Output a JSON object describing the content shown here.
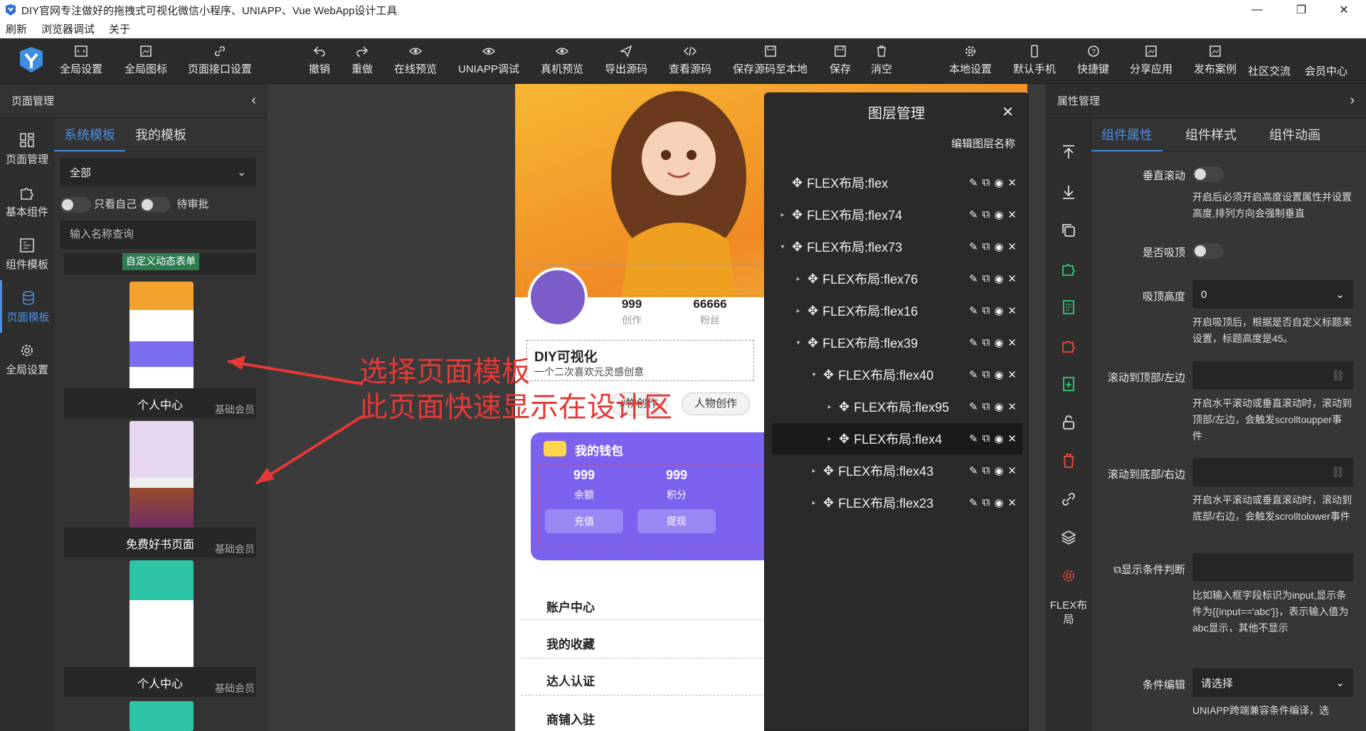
{
  "window": {
    "title": "DIY官网专注做好的拖拽式可视化微信小程序、UNIAPP、Vue WebApp设计工具",
    "menu": [
      "刷新",
      "浏览器调试",
      "关于"
    ]
  },
  "toolbar": {
    "left": [
      "全局设置",
      "全局图标",
      "页面接口设置"
    ],
    "center": [
      "撤销",
      "重做",
      "在线预览",
      "UNIAPP调试",
      "真机预览",
      "导出源码",
      "查看源码",
      "保存源码至本地",
      "保存",
      "消空"
    ],
    "right": [
      "本地设置",
      "默认手机",
      "快捷键",
      "分享应用",
      "发布案例",
      "社区交流",
      "会员中心"
    ]
  },
  "left_panel": {
    "title": "页面管理",
    "rail": [
      "页面管理",
      "基本组件",
      "组件模板",
      "页面模板",
      "全局设置"
    ],
    "active_rail": "页面模板",
    "tabs": [
      "系统模板",
      "我的模板"
    ],
    "filter_select": "全部",
    "toggle_mine": "只看自己",
    "toggle_pending": "待审批",
    "search_placeholder": "输入名称查询",
    "top_item": "自定义动态表单",
    "templates": [
      {
        "name": "个人中心",
        "badge": "基础会员"
      },
      {
        "name": "免费好书页面",
        "badge": "基础会员"
      },
      {
        "name": "个人中心",
        "badge": "基础会员"
      }
    ]
  },
  "annotation": {
    "line1": "选择页面模板",
    "line2": "此页面快速显示在设计区"
  },
  "phone": {
    "stats": [
      {
        "value": "999",
        "label": "创作"
      },
      {
        "value": "66666",
        "label": "粉丝"
      }
    ],
    "brand_title": "DIY可视化",
    "brand_sub": "一个二次喜欢元灵感创意",
    "chips": [
      "#",
      "#物创作",
      "人物创作"
    ],
    "wallet_title": "我的钱包",
    "wallet_stats": [
      {
        "value": "999",
        "label": "余额",
        "btn": "充值"
      },
      {
        "value": "999",
        "label": "积分",
        "btn": "提现"
      }
    ],
    "menu": [
      "账户中心",
      "我的收藏",
      "达人认证",
      "商铺入驻"
    ]
  },
  "layer_panel": {
    "title": "图层管理",
    "edit_names": "编辑图层名称",
    "rows": [
      {
        "label": "FLEX布局:flex",
        "indent": 0,
        "arrow": ""
      },
      {
        "label": "FLEX布局:flex74",
        "indent": 0,
        "arrow": "▸"
      },
      {
        "label": "FLEX布局:flex73",
        "indent": 0,
        "arrow": "▾"
      },
      {
        "label": "FLEX布局:flex76",
        "indent": 1,
        "arrow": "▸"
      },
      {
        "label": "FLEX布局:flex16",
        "indent": 1,
        "arrow": "▸"
      },
      {
        "label": "FLEX布局:flex39",
        "indent": 1,
        "arrow": "▾"
      },
      {
        "label": "FLEX布局:flex40",
        "indent": 2,
        "arrow": "▾"
      },
      {
        "label": "FLEX布局:flex95",
        "indent": 3,
        "arrow": "▸"
      },
      {
        "label": "FLEX布局:flex4",
        "indent": 3,
        "arrow": "▸"
      },
      {
        "label": "FLEX布局:flex43",
        "indent": 2,
        "arrow": "▸"
      },
      {
        "label": "FLEX布局:flex23",
        "indent": 2,
        "arrow": "▸"
      }
    ],
    "selected": "FLEX布局:flex4"
  },
  "right_panel": {
    "title": "属性管理",
    "tabs": [
      "组件属性",
      "组件样式",
      "组件动画"
    ],
    "rail_label": "FLEX布局",
    "vertical_scroll": "垂直滚动",
    "vertical_scroll_desc": "开启后必须开启高度设置属性并设置高度,排列方向会强制垂直",
    "sticky": "是否吸顶",
    "sticky_height": "吸顶高度",
    "sticky_height_value": "0",
    "sticky_desc": "开启吸顶后，根据是否自定义标题来设置，标题高度是45。",
    "scroll_top": "滚动到顶部/左边",
    "scroll_top_desc": "开启水平滚动或垂直滚动时，滚动到顶部/左边，会触发scrolltoupper事件",
    "scroll_bottom": "滚动到底部/右边",
    "scroll_bottom_desc": "开启水平滚动或垂直滚动时，滚动到底部/右边，会触发scrolltolower事件",
    "show_condition": "显示条件判断",
    "show_condition_desc": "比如输入框字段标识为input,显示条件为{{input=='abc'}}，表示输入值为abc显示，其他不显示",
    "cond_edit": "条件编辑",
    "cond_edit_value": "请选择",
    "bottom_cut": "UNIAPP跨端兼容条件编译，选"
  }
}
